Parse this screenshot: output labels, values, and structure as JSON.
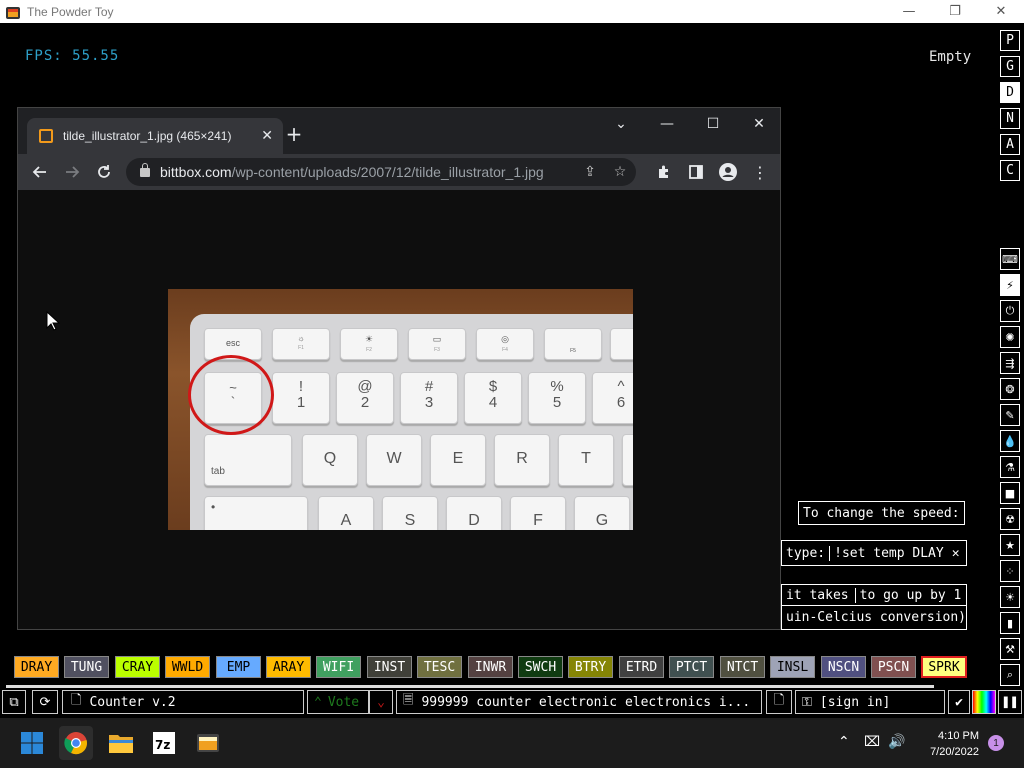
{
  "app": {
    "title": "The Powder Toy",
    "controls": [
      "—",
      "❐",
      "✕"
    ]
  },
  "hud": {
    "fps": "FPS: 55.55",
    "status": "Empty"
  },
  "side_menu": [
    "P",
    "G",
    "D",
    "N",
    "A",
    "C"
  ],
  "categories": [
    {
      "icon": "keyboard-icon",
      "glyph": "⌨"
    },
    {
      "icon": "plug-icon",
      "glyph": "⚡"
    },
    {
      "icon": "power-icon",
      "glyph": "⏻"
    },
    {
      "icon": "explosive-icon",
      "glyph": "✺"
    },
    {
      "icon": "gases-icon",
      "glyph": "⇶"
    },
    {
      "icon": "liquids-icon",
      "glyph": "❂"
    },
    {
      "icon": "powders-icon",
      "glyph": "✎"
    },
    {
      "icon": "drop-icon",
      "glyph": "💧"
    },
    {
      "icon": "flask-icon",
      "glyph": "⚗"
    },
    {
      "icon": "solid-icon",
      "glyph": "■"
    },
    {
      "icon": "radioactive-icon",
      "glyph": "☢"
    },
    {
      "icon": "special-icon",
      "glyph": "★"
    },
    {
      "icon": "life-icon",
      "glyph": "⁘"
    },
    {
      "icon": "bulb-icon",
      "glyph": "☀"
    },
    {
      "icon": "tools-icon",
      "glyph": "▮"
    },
    {
      "icon": "wrench-icon",
      "glyph": "⚒"
    },
    {
      "icon": "search-icon",
      "glyph": "⌕"
    }
  ],
  "browser": {
    "tab_title": "tilde_illustrator_1.jpg (465×241)",
    "new_tab": "+",
    "url_host": "bittbox.com",
    "url_path": "/wp-content/uploads/2007/12/tilde_illustrator_1.jpg",
    "controls": [
      "⌄",
      "—",
      "☐",
      "✕"
    ]
  },
  "keyboard_keys": {
    "esc": "esc",
    "f1": "F1",
    "f2": "F2",
    "f3": "F3",
    "f4": "F4",
    "f5": "F5",
    "tilde_top": "~",
    "tilde_bottom": "`",
    "k1_top": "!",
    "k1": "1",
    "k2_top": "@",
    "k2": "2",
    "k3_top": "#",
    "k3": "3",
    "k4_top": "$",
    "k4": "4",
    "k5_top": "%",
    "k5": "5",
    "k6_top": "^",
    "k6": "6",
    "tab": "tab",
    "q": "Q",
    "w": "W",
    "e": "E",
    "r": "R",
    "t": "T",
    "a": "A",
    "s": "S",
    "d": "D",
    "f": "F",
    "g": "G"
  },
  "tooltips": {
    "speed": "To change the speed:",
    "type_label": "type:",
    "command": "!set temp DLAY",
    "close": "✕",
    "takes": "it takes",
    "go_up": "to go up by 1",
    "conversion": "uin-Celcius conversion)"
  },
  "elements": [
    {
      "name": "DRAY",
      "bg": "#ffaa22",
      "fg": "#000000"
    },
    {
      "name": "TUNG",
      "bg": "#505060",
      "fg": "#ffffff"
    },
    {
      "name": "CRAY",
      "bg": "#bbff00",
      "fg": "#000000"
    },
    {
      "name": "WWLD",
      "bg": "#ffaa00",
      "fg": "#000000"
    },
    {
      "name": "EMP",
      "bg": "#66aaff",
      "fg": "#000000"
    },
    {
      "name": "ARAY",
      "bg": "#ffbb00",
      "fg": "#000000"
    },
    {
      "name": "WIFI",
      "bg": "#40a060",
      "fg": "#ffffff"
    },
    {
      "name": "INST",
      "bg": "#404039",
      "fg": "#ffffff"
    },
    {
      "name": "TESC",
      "bg": "#707040",
      "fg": "#ffffff"
    },
    {
      "name": "INWR",
      "bg": "#544141",
      "fg": "#ffffff"
    },
    {
      "name": "SWCH",
      "bg": "#103b11",
      "fg": "#ffffff"
    },
    {
      "name": "BTRY",
      "bg": "#858505",
      "fg": "#ffffff"
    },
    {
      "name": "ETRD",
      "bg": "#404040",
      "fg": "#ffffff"
    },
    {
      "name": "PTCT",
      "bg": "#405050",
      "fg": "#ffffff"
    },
    {
      "name": "NTCT",
      "bg": "#505040",
      "fg": "#ffffff"
    },
    {
      "name": "INSL",
      "bg": "#9ea3b6",
      "fg": "#000000"
    },
    {
      "name": "NSCN",
      "bg": "#505080",
      "fg": "#ffffff"
    },
    {
      "name": "PSCN",
      "bg": "#805050",
      "fg": "#ffffff"
    },
    {
      "name": "SPRK",
      "bg": "#ffff80",
      "fg": "#000000"
    }
  ],
  "status_bar": {
    "save_name": "Counter v.2",
    "vote": "Vote",
    "save_tags": "999999 counter electronic electronics i...",
    "sign_in": "[sign in]"
  },
  "taskbar": {
    "time": "4:10 PM",
    "date": "7/20/2022",
    "notifications": "1",
    "accent": "#2b88d8"
  }
}
